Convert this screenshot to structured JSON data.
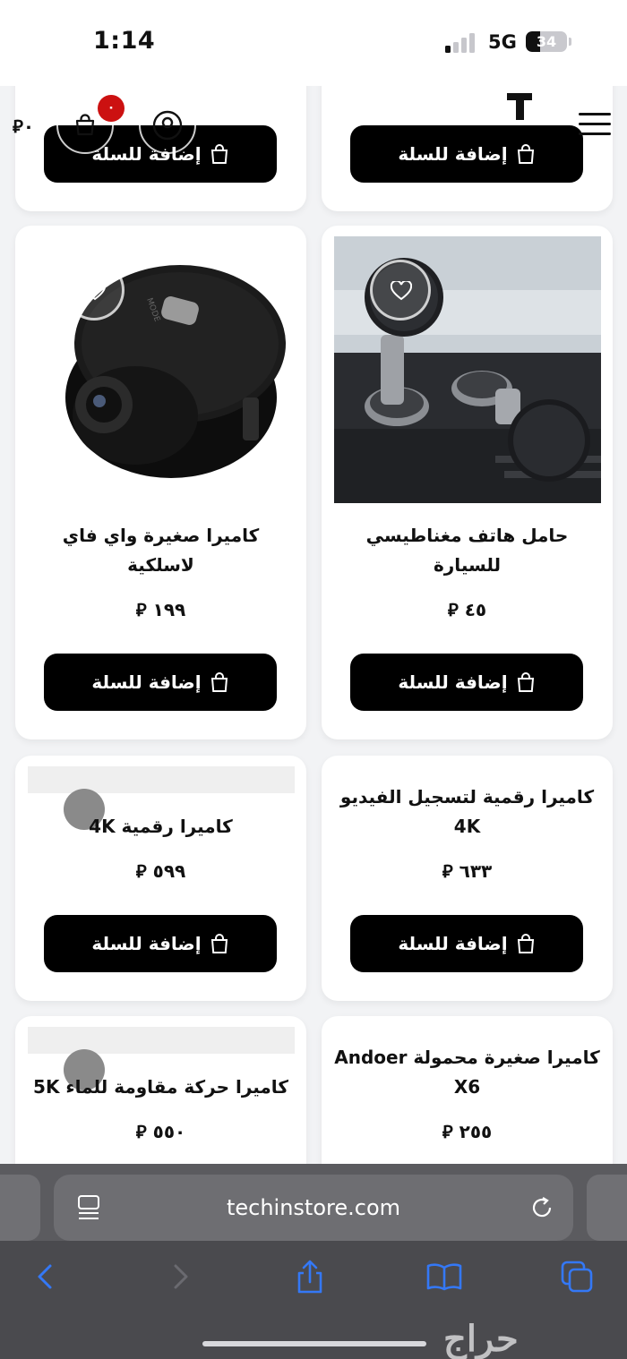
{
  "status_bar": {
    "time": "1:14",
    "network": "5G",
    "battery": "34",
    "battery_level": 0.34,
    "signal_bars_active": 1
  },
  "header": {
    "cart_total": "٠",
    "cart_badge": "٠",
    "currency_symbol": "⃁"
  },
  "products": [
    {
      "title": "",
      "price": "",
      "button_label": "إضافة للسلة"
    },
    {
      "title": "",
      "price": "",
      "button_label": "إضافة للسلة"
    },
    {
      "title": "كاميرا صغيرة واي فاي لاسلكية",
      "price": "١٩٩",
      "currency": "⃁",
      "button_label": "إضافة للسلة"
    },
    {
      "title": "حامل هاتف مغناطيسي للسيارة",
      "price": "٤٥",
      "currency": "⃁",
      "button_label": "إضافة للسلة"
    },
    {
      "title": "كاميرا رقمية 4K",
      "price": "٥٩٩",
      "currency": "⃁",
      "button_label": "إضافة للسلة"
    },
    {
      "title": "كاميرا رقمية لتسجيل الفيديو 4K",
      "price": "٦٣٣",
      "currency": "⃁",
      "button_label": "إضافة للسلة"
    },
    {
      "title": "كاميرا حركة مقاومة للماء 5K",
      "price": "٥٥٠",
      "currency": "⃁"
    },
    {
      "title": "كاميرا صغيرة محمولة Andoer X6",
      "price": "٢٥٥",
      "currency": "⃁"
    }
  ],
  "browser": {
    "url": "techinstore.com"
  },
  "watermark": "حراج",
  "colors": {
    "button": "#000000",
    "badge": "#cc1111",
    "toolbar_icon": "#3478f6",
    "toolbar_bg": "#4a4a4e"
  }
}
